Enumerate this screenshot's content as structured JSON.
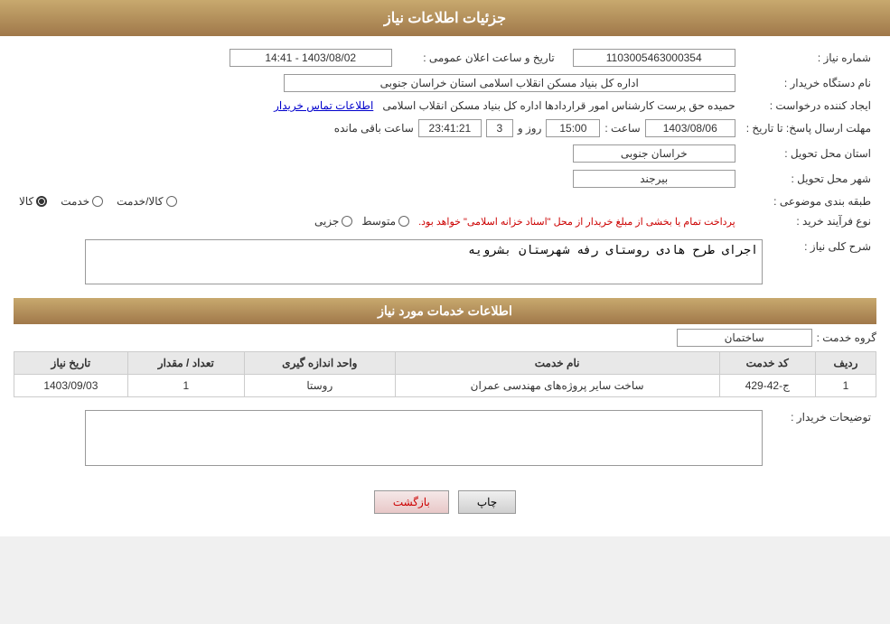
{
  "header": {
    "title": "جزئیات اطلاعات نیاز"
  },
  "fields": {
    "need_number_label": "شماره نیاز :",
    "need_number_value": "1103005463000354",
    "announce_label": "تاریخ و ساعت اعلان عمومی :",
    "announce_value": "1403/08/02 - 14:41",
    "buyer_org_label": "نام دستگاه خریدار :",
    "buyer_org_value": "اداره کل بنیاد مسکن انقلاب اسلامی استان خراسان جنوبی",
    "creator_label": "ایجاد کننده درخواست :",
    "creator_value": "حمیده حق پرست کارشناس امور قراردادها اداره کل بنیاد مسکن انقلاب اسلامی",
    "contact_link": "اطلاعات تماس خریدار",
    "deadline_label": "مهلت ارسال پاسخ: تا تاریخ :",
    "deadline_date": "1403/08/06",
    "deadline_time_label": "ساعت :",
    "deadline_time": "15:00",
    "deadline_days_label": "روز و",
    "deadline_days": "3",
    "deadline_countdown": "23:41:21",
    "deadline_remaining": "ساعت باقی مانده",
    "province_label": "استان محل تحویل :",
    "province_value": "خراسان جنوبی",
    "city_label": "شهر محل تحویل :",
    "city_value": "بیرجند",
    "category_label": "طبقه بندی موضوعی :",
    "category_options": [
      "کالا",
      "خدمت",
      "کالا/خدمت"
    ],
    "category_selected": "کالا",
    "process_label": "نوع فرآیند خرید :",
    "process_options": [
      "جزیی",
      "متوسط"
    ],
    "process_note": "پرداخت تمام یا بخشی از مبلغ خریدار از محل \"اسناد خزانه اسلامی\" خواهد بود.",
    "description_label": "شرح کلی نیاز :",
    "description_value": "اجرای طرح هادی روستای رفه شهرستان بشرویه"
  },
  "services_section": {
    "title": "اطلاعات خدمات مورد نیاز",
    "service_group_label": "گروه خدمت :",
    "service_group_value": "ساختمان",
    "table": {
      "headers": [
        "ردیف",
        "کد خدمت",
        "نام خدمت",
        "واحد اندازه گیری",
        "تعداد / مقدار",
        "تاریخ نیاز"
      ],
      "rows": [
        {
          "row_num": "1",
          "code": "ج-42-429",
          "name": "ساخت سایر پروژه‌های مهندسی عمران",
          "unit": "روستا",
          "quantity": "1",
          "date": "1403/09/03"
        }
      ]
    }
  },
  "buyer_desc": {
    "label": "توضیحات خریدار :",
    "value": ""
  },
  "buttons": {
    "print": "چاپ",
    "back": "بازگشت"
  }
}
